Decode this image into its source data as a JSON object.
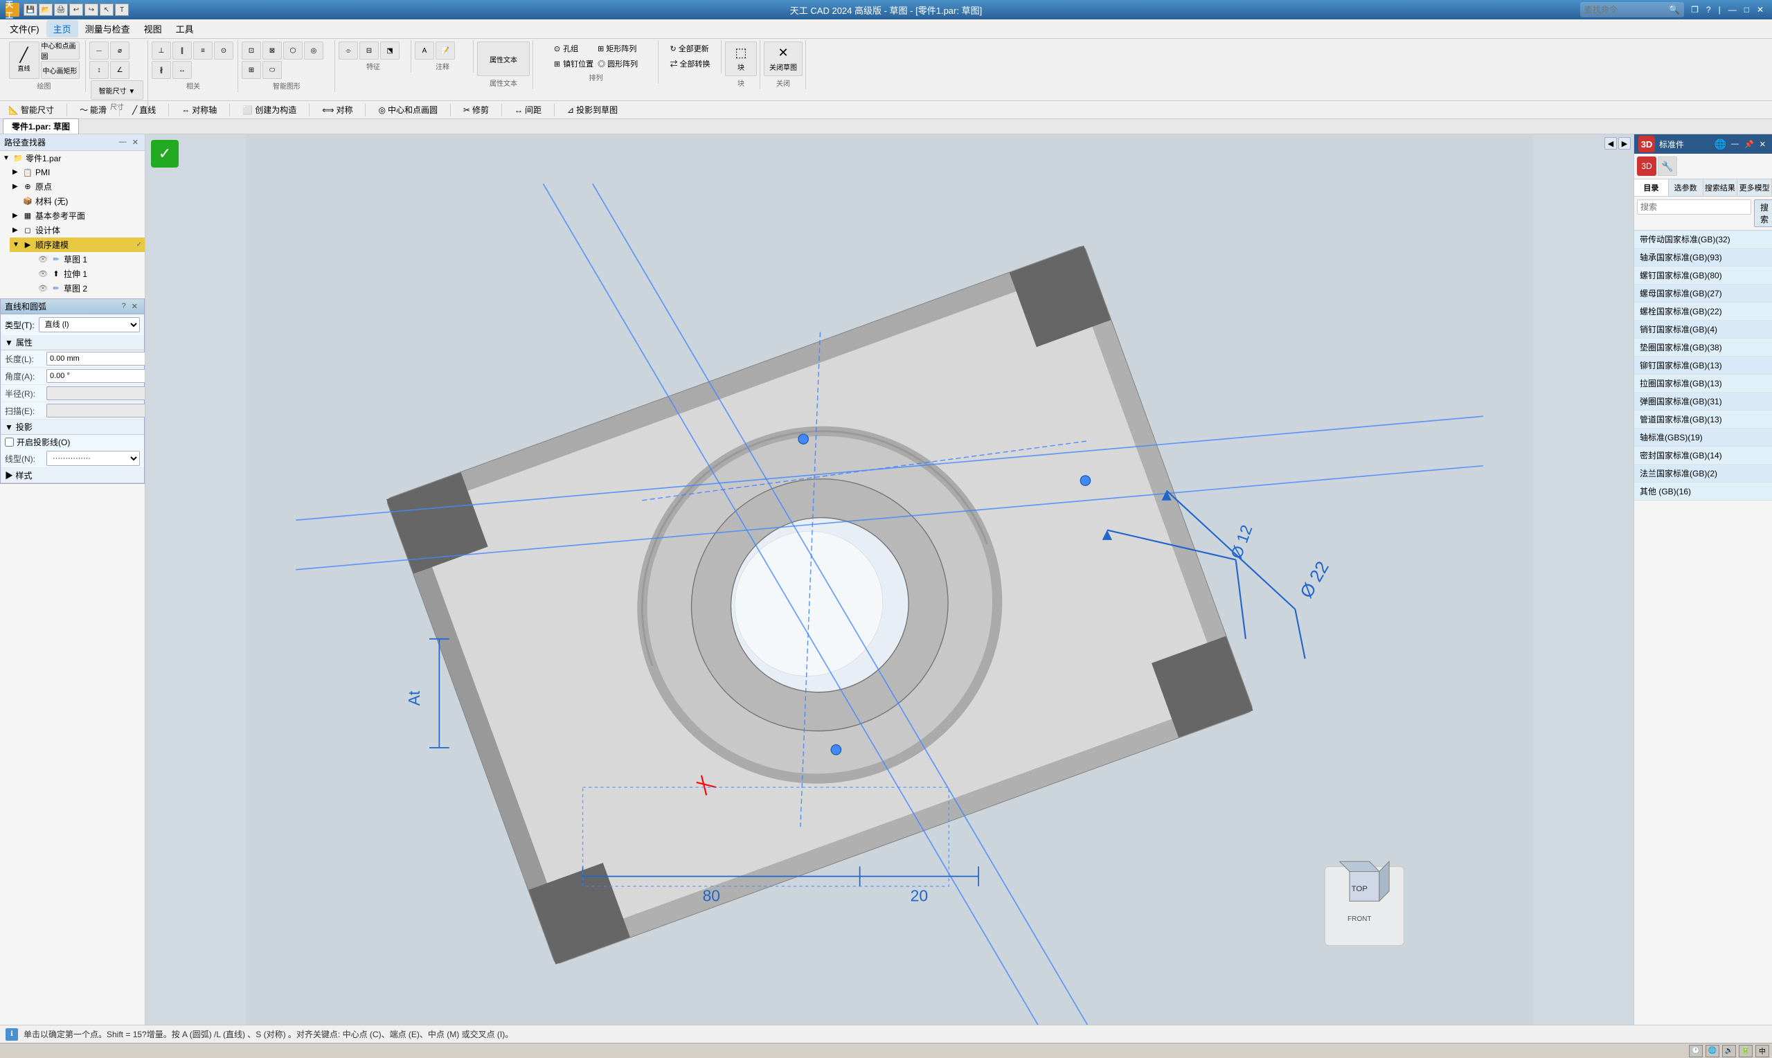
{
  "app": {
    "title": "天工 CAD 2024 高级版 - 草图 - [零件1.par: 草图]",
    "icon": "天工"
  },
  "title_controls": {
    "minimize": "—",
    "maximize": "□",
    "close": "✕",
    "restore": "❐",
    "help": "?",
    "pin": "📌"
  },
  "menu": {
    "items": [
      "文件(F)",
      "主页",
      "测量与检查",
      "视图",
      "工具"
    ]
  },
  "toolbar": {
    "groups": [
      {
        "label": "绘图",
        "tools": [
          "直线",
          "中心和点画圆",
          "中心画矩形"
        ]
      },
      {
        "label": "尺寸",
        "tools": [
          "智能尺寸"
        ]
      },
      {
        "label": "相关",
        "tools": []
      },
      {
        "label": "智能图形",
        "tools": []
      },
      {
        "label": "特征",
        "tools": []
      },
      {
        "label": "注释",
        "tools": []
      },
      {
        "label": "属性文本",
        "tools": []
      },
      {
        "label": "排列",
        "tools": []
      },
      {
        "label": "块",
        "tools": []
      },
      {
        "label": "关闭",
        "tools": [
          "关闭草图"
        ]
      }
    ]
  },
  "toolbar2": {
    "items": [
      "智能尺寸",
      "能滑",
      "直线",
      "对称轴",
      "创建为构造",
      "对称",
      "中心和点画圆",
      "修剪",
      "间距",
      "投影到草图"
    ]
  },
  "tab_bar": {
    "tabs": [
      "零件1.par: 草图"
    ]
  },
  "left_panel": {
    "title": "路径查找器",
    "tree": {
      "root": "零件1.par",
      "items": [
        {
          "label": "PMI",
          "level": 1,
          "icon": "📋"
        },
        {
          "label": "原点",
          "level": 1,
          "icon": "⊕"
        },
        {
          "label": "材料 (无)",
          "level": 1,
          "icon": "📦"
        },
        {
          "label": "基本参考平面",
          "level": 1,
          "icon": "▦"
        },
        {
          "label": "设计体",
          "level": 1,
          "icon": "◻"
        },
        {
          "label": "顺序建模",
          "level": 1,
          "icon": "▶",
          "highlighted": true,
          "children": [
            {
              "label": "草图 1",
              "level": 2,
              "icon": "✏"
            },
            {
              "label": "拉伸 1",
              "level": 2,
              "icon": "⬆"
            },
            {
              "label": "草图 2",
              "level": 2,
              "icon": "✏"
            }
          ]
        }
      ]
    }
  },
  "line_arc_dialog": {
    "title": "直线和圆弧",
    "type_label": "类型(T):",
    "type_value": "直线 (l)",
    "sections": {
      "attributes": {
        "title": "属性",
        "fields": [
          {
            "label": "长度(L):",
            "value": "0.00 mm",
            "enabled": true
          },
          {
            "label": "角度(A):",
            "value": "0.00 °",
            "enabled": true
          },
          {
            "label": "半径(R):",
            "value": "",
            "enabled": false
          },
          {
            "label": "扫描(E):",
            "value": "",
            "enabled": false
          }
        ]
      },
      "projection": {
        "title": "投影",
        "checkbox": "开启投影线(O)",
        "line_type_label": "线型(N):",
        "line_type_value": "···············"
      },
      "style": {
        "title": "样式"
      }
    }
  },
  "right_panel": {
    "title": "标准件",
    "tabs": [
      "目录",
      "选参数",
      "搜索结果",
      "更多模型"
    ],
    "search_placeholder": "搜索",
    "search_btn": "搜索",
    "items": [
      "带传动国家标准(GB)(32)",
      "轴承国家标准(GB)(93)",
      "螺钉国家标准(GB)(80)",
      "螺母国家标准(GB)(27)",
      "螺栓国家标准(GB)(22)",
      "销钉国家标准(GB)(4)",
      "垫圈国家标准(GB)(38)",
      "铆钉国家标准(GB)(13)",
      "拉圈国家标准(GB)(13)",
      "弹圈国家标准(GB)(31)",
      "管道国家标准(GB)(13)",
      "轴标准(GBS)(19)",
      "密封国家标准(GB)(14)",
      "法兰国家标准(GB)(2)",
      "其他 (GB)(16)"
    ]
  },
  "status_bar": {
    "message": "单击以确定第一个点。Shift = 15?增量。按 A (圆弧) /L (直线) 、S (对称) 。对齐关键点: 中心点 (C)、端点 (E)、中点 (M) 或交叉点 (I)。"
  },
  "cad": {
    "dimension1": "Ø 22",
    "dimension2": "Ø 12",
    "dimension3": "80",
    "dimension4": "20"
  },
  "colors": {
    "toolbar_bg": "#f5f5f5",
    "panel_header": "#4a7ab8",
    "highlight_yellow": "#e8d060",
    "highlight_blue": "#d8eaf8",
    "accent_blue": "#4a90d0",
    "app_gradient_top": "#4a90c8",
    "app_gradient_bot": "#2a6098",
    "viewport_bg": "#c8d0d8"
  }
}
